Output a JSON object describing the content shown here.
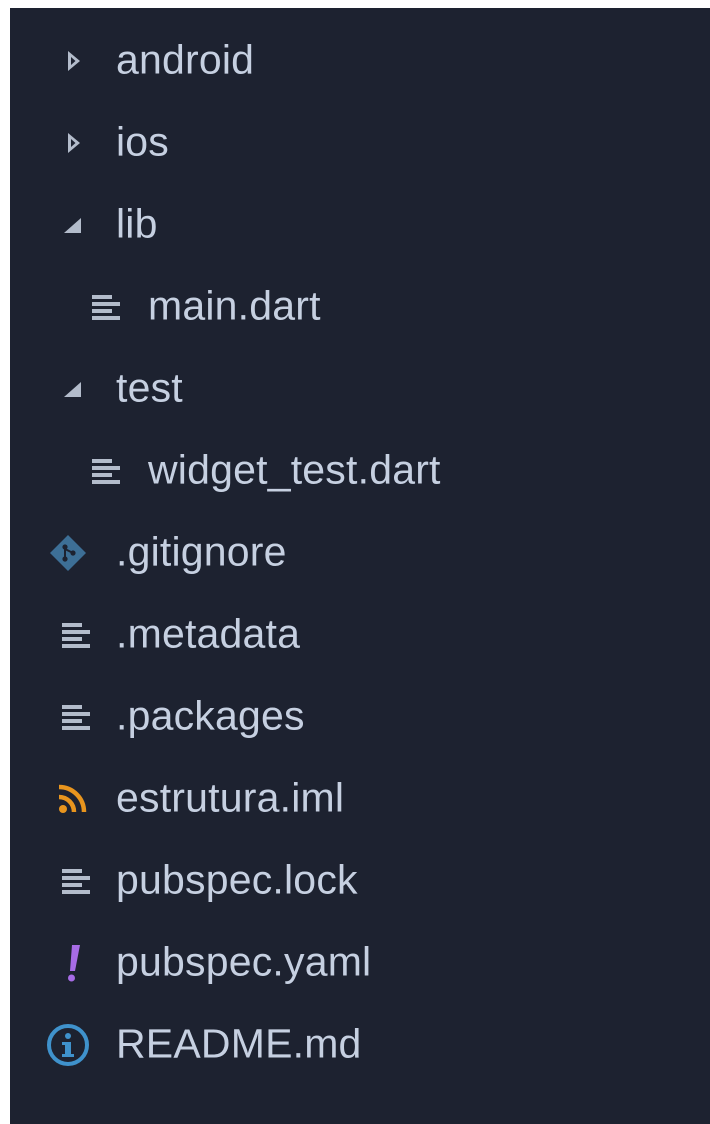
{
  "explorer": {
    "items": [
      {
        "label": "android",
        "icon": "chevron-right-icon",
        "level": 0
      },
      {
        "label": "ios",
        "icon": "chevron-right-icon",
        "level": 0
      },
      {
        "label": "lib",
        "icon": "chevron-down-icon",
        "level": 0
      },
      {
        "label": "main.dart",
        "icon": "file-lines-icon",
        "level": 1
      },
      {
        "label": "test",
        "icon": "chevron-down-icon",
        "level": 0
      },
      {
        "label": "widget_test.dart",
        "icon": "file-lines-icon",
        "level": 1
      },
      {
        "label": ".gitignore",
        "icon": "git-icon",
        "level": 0
      },
      {
        "label": ".metadata",
        "icon": "file-lines-icon",
        "level": 0
      },
      {
        "label": ".packages",
        "icon": "file-lines-icon",
        "level": 0
      },
      {
        "label": "estrutura.iml",
        "icon": "rss-icon",
        "level": 0
      },
      {
        "label": "pubspec.lock",
        "icon": "file-lines-icon",
        "level": 0
      },
      {
        "label": "pubspec.yaml",
        "icon": "exclamation-icon",
        "level": 0
      },
      {
        "label": "README.md",
        "icon": "info-icon",
        "level": 0
      }
    ]
  },
  "colors": {
    "background": "#1d2230",
    "text": "#c6d0e1",
    "icon_gray": "#b3bccb",
    "git_blue": "#3d6f96",
    "rss_orange": "#e8951e",
    "yaml_purple": "#a76ce6",
    "info_blue": "#3f92cc"
  }
}
